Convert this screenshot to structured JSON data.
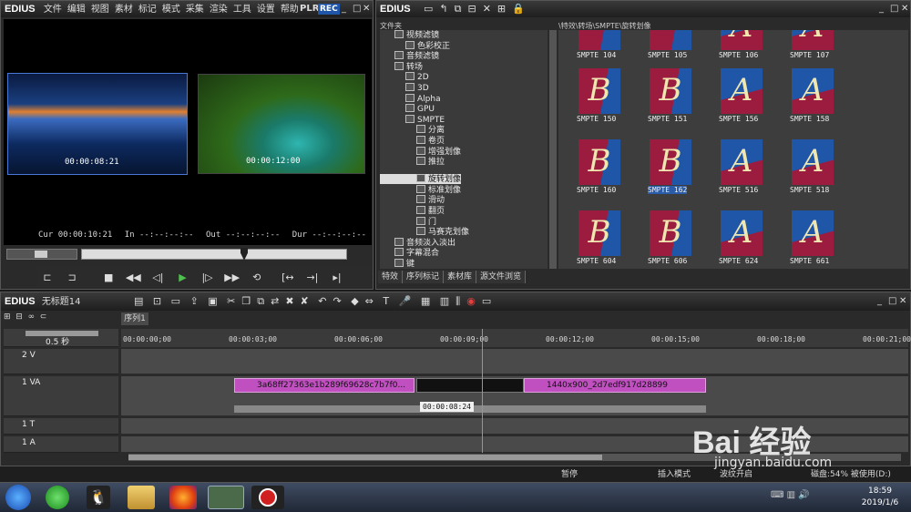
{
  "player": {
    "brand": "EDIUS",
    "menu": [
      "文件",
      "编辑",
      "视图",
      "素材",
      "标记",
      "模式",
      "采集",
      "渲染",
      "工具",
      "设置",
      "帮助"
    ],
    "plr": "PLR",
    "rec": "REC",
    "left_tc": "00:00:08:21",
    "right_tc": "00:00:12:00",
    "cur_label": "Cur",
    "cur": "00:00:10:21",
    "in_label": "In",
    "in": "--:--:--:--",
    "out_label": "Out",
    "out": "--:--:--:--",
    "dur_label": "Dur",
    "dur": "--:--:--:--"
  },
  "bin": {
    "brand": "EDIUS",
    "tree_header": "文件夹",
    "path": "\\特效\\转场\\SMPTE\\旋转划像",
    "tree": [
      {
        "label": "视频滤镜",
        "indent": 1
      },
      {
        "label": "色彩校正",
        "indent": 2
      },
      {
        "label": "音频滤镜",
        "indent": 1
      },
      {
        "label": "转场",
        "indent": 1
      },
      {
        "label": "2D",
        "indent": 2
      },
      {
        "label": "3D",
        "indent": 2
      },
      {
        "label": "Alpha",
        "indent": 2
      },
      {
        "label": "GPU",
        "indent": 2
      },
      {
        "label": "SMPTE",
        "indent": 2
      },
      {
        "label": "分离",
        "indent": 3
      },
      {
        "label": "卷页",
        "indent": 3
      },
      {
        "label": "增强划像",
        "indent": 3
      },
      {
        "label": "推拉",
        "indent": 3
      },
      {
        "label": "旋转划像",
        "indent": 3
      },
      {
        "label": "标准划像",
        "indent": 3
      },
      {
        "label": "滑动",
        "indent": 3
      },
      {
        "label": "翻页",
        "indent": 3
      },
      {
        "label": "门",
        "indent": 3
      },
      {
        "label": "马赛克划像",
        "indent": 3
      },
      {
        "label": "音频淡入淡出",
        "indent": 1
      },
      {
        "label": "字幕混合",
        "indent": 1
      },
      {
        "label": "键",
        "indent": 1
      }
    ],
    "effects": [
      {
        "label": "SMPTE  104",
        "letter": ""
      },
      {
        "label": "SMPTE  105",
        "letter": ""
      },
      {
        "label": "SMPTE  106",
        "letter": "A"
      },
      {
        "label": "SMPTE  107",
        "letter": "A"
      },
      {
        "label": "SMPTE  150",
        "letter": "B"
      },
      {
        "label": "SMPTE  151",
        "letter": "B"
      },
      {
        "label": "SMPTE  156",
        "letter": "A"
      },
      {
        "label": "SMPTE  158",
        "letter": "A"
      },
      {
        "label": "SMPTE  160",
        "letter": "B"
      },
      {
        "label": "SMPTE  162",
        "letter": "B"
      },
      {
        "label": "SMPTE  516",
        "letter": "A"
      },
      {
        "label": "SMPTE  518",
        "letter": "A"
      },
      {
        "label": "SMPTE  604",
        "letter": "B"
      },
      {
        "label": "SMPTE  606",
        "letter": "B"
      },
      {
        "label": "SMPTE  624",
        "letter": "A"
      },
      {
        "label": "SMPTE  661",
        "letter": "A"
      }
    ],
    "selected_effect": "SMPTE  162",
    "tabs": [
      "特效",
      "序列标记",
      "素材库",
      "源文件浏览"
    ]
  },
  "timeline": {
    "brand": "EDIUS",
    "project": "无标题14",
    "sequence_tab": "序列1",
    "zoom": "0.5 秒",
    "ruler": [
      "00:00:00;00",
      "00:00:03;00",
      "00:00:06;00",
      "00:00:09;00",
      "00:00:12;00",
      "00:00:15;00",
      "00:00:18;00",
      "00:00:21;00"
    ],
    "tracks": [
      "2 V",
      "1 VA",
      "1 T",
      "1 A"
    ],
    "clip1_name": "3a68ff27363e1b289f69628c7b7f0...",
    "clip2_name": "1440x900_2d7edf917d28899",
    "transition_tooltip": "00:00:08:24"
  },
  "status": {
    "pause": "暂停",
    "insert_mode": "插入模式",
    "ripple": "波纹开启",
    "disk": "磁盘:54% 被使用(D:)"
  },
  "taskbar": {
    "time": "18:59",
    "date": "2019/1/6"
  },
  "watermark": {
    "text": "Bai 经验",
    "url": "jingyan.baidu.com"
  },
  "colors": {
    "accent": "#2a5caa",
    "clip": "#c04fc0",
    "rec": "#1f56a8"
  }
}
